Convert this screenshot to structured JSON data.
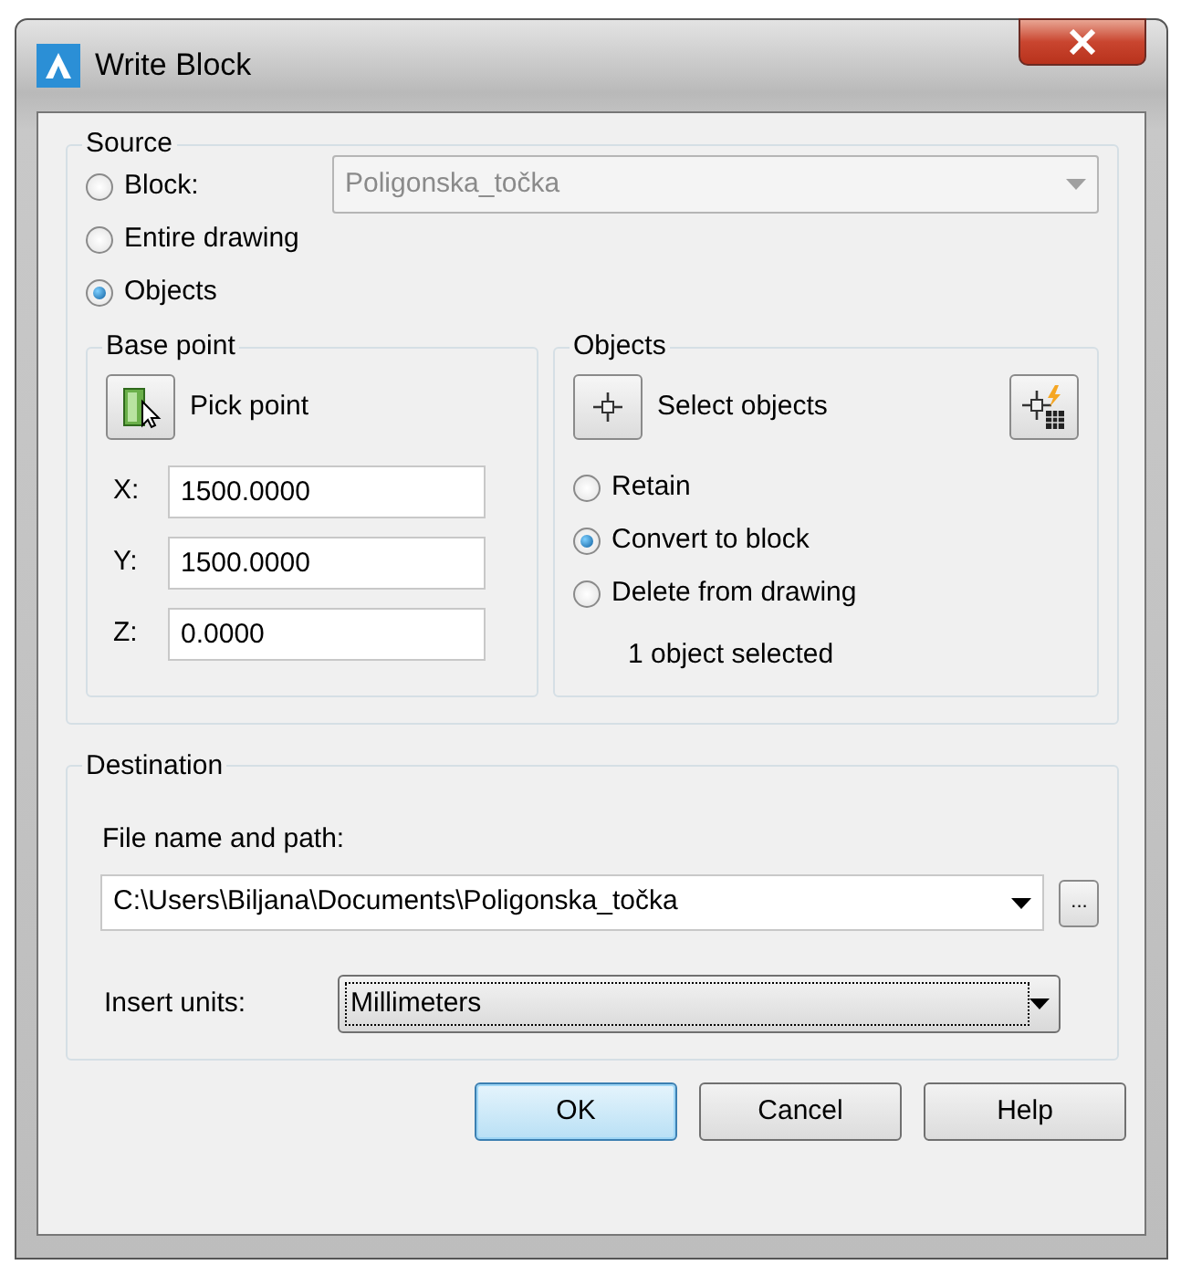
{
  "window": {
    "title": "Write Block"
  },
  "source": {
    "title": "Source",
    "options": [
      {
        "label": "Block:",
        "selected": false
      },
      {
        "label": "Entire drawing",
        "selected": false
      },
      {
        "label": "Objects",
        "selected": true
      }
    ],
    "block_select": {
      "value": "Poligonska_točka",
      "disabled": true
    }
  },
  "base_point": {
    "title": "Base point",
    "pick_button": "Pick point",
    "coords": [
      {
        "label": "X:",
        "value": "1500.0000"
      },
      {
        "label": "Y:",
        "value": "1500.0000"
      },
      {
        "label": "Z:",
        "value": "0.0000"
      }
    ]
  },
  "objects": {
    "title": "Objects",
    "select_button": "Select objects",
    "options": [
      {
        "label": "Retain",
        "selected": false
      },
      {
        "label": "Convert to block",
        "selected": true
      },
      {
        "label": "Delete from drawing",
        "selected": false
      }
    ],
    "status": "1 object selected"
  },
  "destination": {
    "title": "Destination",
    "file_label": "File name and path:",
    "file_path": "C:\\Users\\Biljana\\Documents\\Poligonska_točka",
    "browse_button": "...",
    "units_label": "Insert units:",
    "units": "Millimeters"
  },
  "buttons": [
    {
      "label": "OK",
      "default": true
    },
    {
      "label": "Cancel",
      "default": false
    },
    {
      "label": "Help",
      "default": false
    }
  ]
}
